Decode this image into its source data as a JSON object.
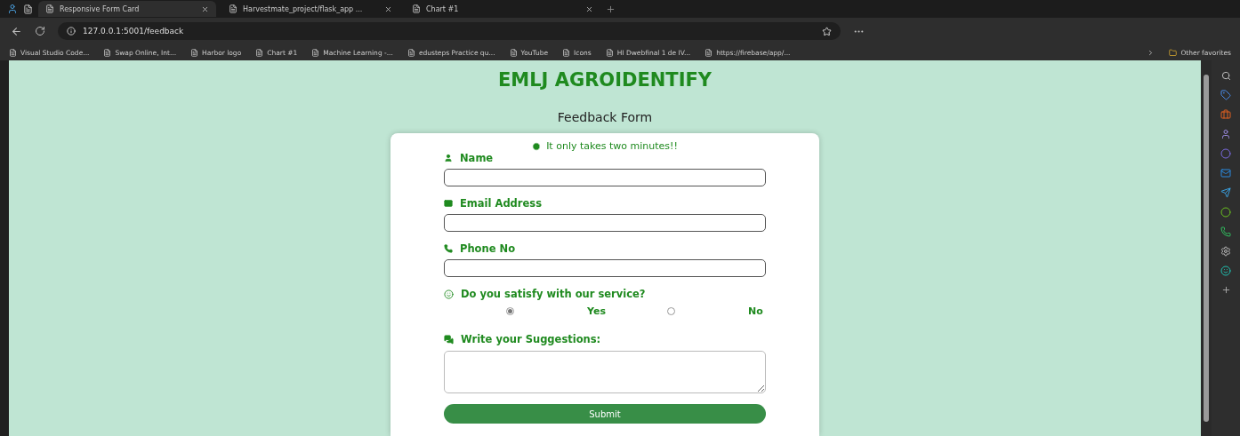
{
  "browser": {
    "tabs": [
      {
        "title": "Responsive Form Card",
        "selected": true
      },
      {
        "title": "Harvestmate_project/flask_app ...",
        "selected": false
      },
      {
        "title": "Chart #1",
        "selected": false
      }
    ],
    "address": "127.0.0.1:5001/feedback",
    "bookmarks": [
      "Visual Studio Code...",
      "Swap Online, Int...",
      "Harbor logo",
      "Chart #1",
      "Machine Learning -...",
      "edusteps Practice qu...",
      "YouTube",
      "Icons",
      "HI Dwebfinal 1 de IV...",
      "https://firebase/app/..."
    ],
    "other_favorites": "Other favorites"
  },
  "page": {
    "title": "EMLJ AGROIDENTIFY",
    "heading": "Feedback Form",
    "form": {
      "note": "It only takes two minutes!!",
      "fields": [
        {
          "label": "Name"
        },
        {
          "label": "Email Address"
        },
        {
          "label": "Phone No"
        }
      ],
      "question": "Do you satisfy with our service?",
      "options": [
        {
          "label": "Yes",
          "selected": true
        },
        {
          "label": "No",
          "selected": false
        }
      ],
      "suggestions_label": "Write your Suggestions:",
      "submit": "Submit"
    }
  }
}
